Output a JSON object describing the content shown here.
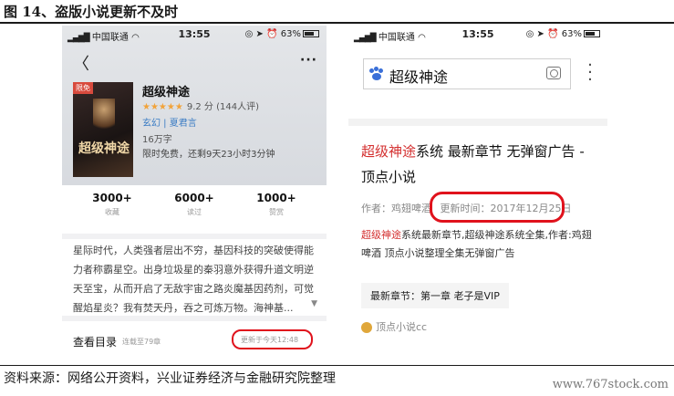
{
  "figure": {
    "title": "图 14、盗版小说更新不及时",
    "source": "资料来源：网络公开资料，兴业证券经济与金融研究院整理",
    "watermark": "www.767stock.com"
  },
  "left_phone": {
    "status": {
      "carrier": "中国联通",
      "time": "13:55",
      "battery": "63%"
    },
    "book": {
      "title": "超级神途",
      "cover_tag": "限免",
      "cover_title": "超级神途",
      "rating": "9.2 分 (144人评)",
      "stars": "★★★★★",
      "genre": "玄幻",
      "author": "夏君言",
      "words": "16万字",
      "free_notice": "限时免费，还剩9天23小时3分钟"
    },
    "stats": [
      {
        "value": "3000+",
        "label": "收藏"
      },
      {
        "value": "6000+",
        "label": "读过"
      },
      {
        "value": "1000+",
        "label": "赞赏"
      }
    ],
    "description": "星际时代，人类强者层出不穷，基因科技的突破使得能力者称霸星空。出身垃圾星的秦羽意外获得升道文明逆天至宝，从而开启了无敌宇宙之路炎魔基因药剂，可觉醒焰星炎？我有焚天丹，吞之可炼万物。海神基...",
    "toc": {
      "label": "查看目录",
      "sub": "连载至79章",
      "update": "更新于今天12:48"
    }
  },
  "right_phone": {
    "status": {
      "carrier": "中国联通",
      "time": "13:55",
      "battery": "63%"
    },
    "search": {
      "query": "超级神途"
    },
    "result": {
      "title_red": "超级神途",
      "title_rest": "系统 最新章节 无弹窗广告 - 顶点小说",
      "author_label": "作者：",
      "author": "鸡翅啤酒",
      "update_time": "更新时间：2017年12月25日",
      "snippet_red": "超级神途",
      "snippet_rest": "系统最新章节,超级神途系统全集,作者:鸡翅啤酒 顶点小说整理全集无弹窗广告",
      "latest": "最新章节：第一章 老子是VIP",
      "site": "顶点小说cc"
    }
  },
  "colors": {
    "highlight_oval": "#e0121c",
    "link_blue": "#3b7cc4",
    "title_red": "#d43030"
  }
}
